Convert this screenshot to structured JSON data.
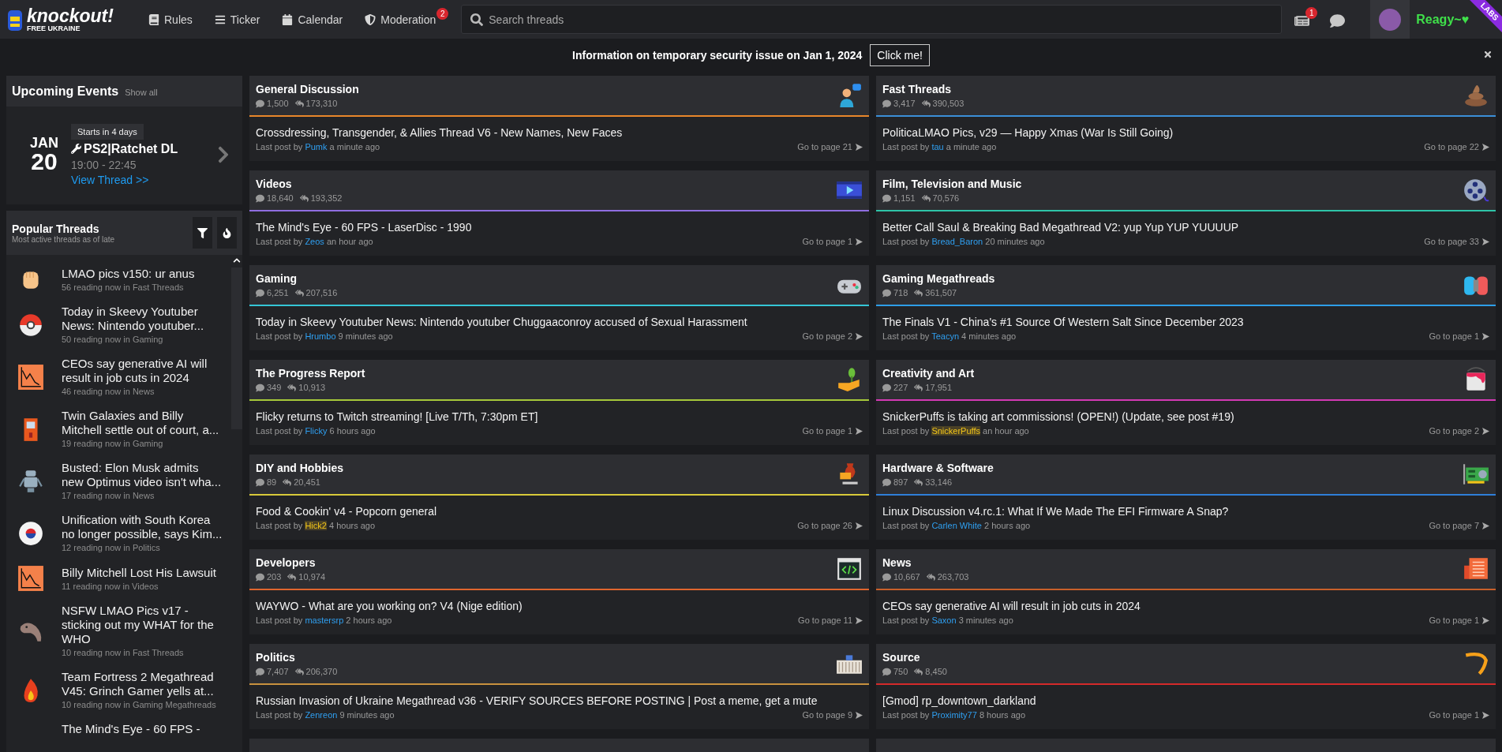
{
  "header": {
    "logo": {
      "name": "knockout!",
      "tagline": "FREE UKRAINE"
    },
    "nav": [
      {
        "kind": "rules",
        "label": "Rules"
      },
      {
        "kind": "ticker",
        "label": "Ticker"
      },
      {
        "kind": "calendar",
        "label": "Calendar"
      },
      {
        "kind": "moderation",
        "label": "Moderation",
        "badge": "2"
      }
    ],
    "search": {
      "placeholder": "Search threads"
    },
    "inbox_badge": "1",
    "username": "Reagy~♥",
    "ribbon": "LABS"
  },
  "banner": {
    "text": "Information on temporary security issue on Jan 1, 2024",
    "button": "Click me!"
  },
  "upcoming_events": {
    "title": "Upcoming Events",
    "show_all": "Show all",
    "event": {
      "month": "JAN",
      "day": "20",
      "starts": "Starts in 4 days",
      "title": "PS2|Ratchet DL",
      "time": "19:00 - 22:45",
      "link": "View Thread >>"
    }
  },
  "popular_threads": {
    "title": "Popular Threads",
    "subtitle": "Most active threads as of late",
    "items": [
      {
        "title": "LMAO pics v150: ur anus",
        "meta": "56 reading now in Fast Threads"
      },
      {
        "title": "Today in Skeevy Youtuber News: Nintendo youtuber...",
        "meta": "50 reading now in Gaming"
      },
      {
        "title": "CEOs say generative AI will result in job cuts in 2024",
        "meta": "46 reading now in News"
      },
      {
        "title": "Twin Galaxies and Billy Mitchell settle out of court, a...",
        "meta": "19 reading now in Gaming"
      },
      {
        "title": "Busted: Elon Musk admits new Optimus video isn't wha...",
        "meta": "17 reading now in News"
      },
      {
        "title": "Unification with South Korea no longer possible, says Kim...",
        "meta": "12 reading now in Politics"
      },
      {
        "title": "Billy Mitchell Lost His Lawsuit",
        "meta": "11 reading now in Videos"
      },
      {
        "title": "NSFW LMAO Pics v17 - sticking out my WHAT for the WHO",
        "meta": "10 reading now in Fast Threads"
      },
      {
        "title": "Team Fortress 2 Megathread V45: Grinch Gamer yells at...",
        "meta": "10 reading now in Gaming Megathreads"
      },
      {
        "title": "The Mind's Eye - 60 FPS -"
      }
    ]
  },
  "columns": [
    {
      "categories": [
        {
          "name": "General Discussion",
          "threads": "1,500",
          "posts": "173,310",
          "color": "#e8862a",
          "thread": "Crossdressing, Transgender, & Allies Thread V6 - New Names, New Faces",
          "last_post": {
            "prefix": "Last post by",
            "user": "Pumk",
            "highlighted": false,
            "time": "a minute ago"
          },
          "page": "Go to page 21"
        },
        {
          "name": "Videos",
          "threads": "18,640",
          "posts": "193,352",
          "color": "#8f6ee0",
          "thread": "The Mind's Eye - 60 FPS - LaserDisc - 1990",
          "last_post": {
            "prefix": "Last post by",
            "user": "Zeos",
            "highlighted": false,
            "time": "an hour ago"
          },
          "page": "Go to page 1"
        },
        {
          "name": "Gaming",
          "threads": "6,251",
          "posts": "207,516",
          "color": "#35c6d6",
          "thread": "Today in Skeevy Youtuber News: Nintendo youtuber Chuggaaconroy accused of Sexual Harassment",
          "last_post": {
            "prefix": "Last post by",
            "user": "Hrumbo",
            "highlighted": false,
            "time": "9 minutes ago"
          },
          "page": "Go to page 2"
        },
        {
          "name": "The Progress Report",
          "threads": "349",
          "posts": "10,913",
          "color": "#a6c93a",
          "thread": "Flicky returns to Twitch streaming! [Live T/Th, 7:30pm ET]",
          "last_post": {
            "prefix": "Last post by",
            "user": "Flicky",
            "highlighted": false,
            "time": "6 hours ago"
          },
          "page": "Go to page 1"
        },
        {
          "name": "DIY and Hobbies",
          "threads": "89",
          "posts": "20,451",
          "color": "#d8c93a",
          "thread": "Food & Cookin' v4 - Popcorn general",
          "last_post": {
            "prefix": "Last post by",
            "user": "Hick2",
            "highlighted": true,
            "time": "4 hours ago"
          },
          "page": "Go to page 26"
        },
        {
          "name": "Developers",
          "threads": "203",
          "posts": "10,974",
          "color": "#e0652e",
          "thread": "WAYWO - What are you working on? V4 (Nige edition)",
          "last_post": {
            "prefix": "Last post by",
            "user": "mastersrp",
            "highlighted": false,
            "time": "2 hours ago"
          },
          "page": "Go to page 11"
        },
        {
          "name": "Politics",
          "threads": "7,407",
          "posts": "206,370",
          "color": "#c8913e",
          "thread": "Russian Invasion of Ukraine Megathread v36 - VERIFY SOURCES BEFORE POSTING | Post a meme, get a mute",
          "last_post": {
            "prefix": "Last post by",
            "user": "Zenreon",
            "highlighted": false,
            "time": "9 minutes ago"
          },
          "page": "Go to page 9"
        }
      ]
    },
    {
      "categories": [
        {
          "name": "Fast Threads",
          "threads": "3,417",
          "posts": "390,503",
          "color": "#3b8fd8",
          "thread": "PoliticaLMAO Pics, v29 — Happy Xmas (War Is Still Going)",
          "last_post": {
            "prefix": "Last post by",
            "user": "tau",
            "highlighted": false,
            "time": "a minute ago"
          },
          "page": "Go to page 22"
        },
        {
          "name": "Film, Television and Music",
          "threads": "1,151",
          "posts": "70,576",
          "color": "#2ec4a8",
          "thread": "Better Call Saul & Breaking Bad Megathread V2: yup Yup YUP YUUUUP",
          "last_post": {
            "prefix": "Last post by",
            "user": "Bread_Baron",
            "highlighted": false,
            "time": "20 minutes ago"
          },
          "page": "Go to page 33"
        },
        {
          "name": "Gaming Megathreads",
          "threads": "718",
          "posts": "361,507",
          "color": "#2e9ee8",
          "thread": "The Finals V1 - China's #1 Source Of Western Salt Since December 2023",
          "last_post": {
            "prefix": "Last post by",
            "user": "Teacyn",
            "highlighted": false,
            "time": "4 minutes ago"
          },
          "page": "Go to page 1"
        },
        {
          "name": "Creativity and Art",
          "threads": "227",
          "posts": "17,951",
          "color": "#d43ab4",
          "thread": "SnickerPuffs is taking art commissions! (OPEN!) (Update, see post #19)",
          "last_post": {
            "prefix": "Last post by",
            "user": "SnickerPuffs",
            "highlighted": true,
            "time": "an hour ago"
          },
          "page": "Go to page 2"
        },
        {
          "name": "Hardware & Software",
          "threads": "897",
          "posts": "33,146",
          "color": "#2e7ed8",
          "thread": "Linux Discussion v4.rc.1: What If We Made The EFI Firmware A Snap?",
          "last_post": {
            "prefix": "Last post by",
            "user": "Carlen White",
            "highlighted": false,
            "time": "2 hours ago"
          },
          "page": "Go to page 7"
        },
        {
          "name": "News",
          "threads": "10,667",
          "posts": "263,703",
          "color": "#c8602a",
          "thread": "CEOs say generative AI will result in job cuts in 2024",
          "last_post": {
            "prefix": "Last post by",
            "user": "Saxon",
            "highlighted": false,
            "time": "3 minutes ago"
          },
          "page": "Go to page 1"
        },
        {
          "name": "Source",
          "threads": "750",
          "posts": "8,450",
          "color": "#d42a2a",
          "thread": "[Gmod] rp_downtown_darkland",
          "last_post": {
            "prefix": "Last post by",
            "user": "Proximity77",
            "highlighted": false,
            "time": "8 hours ago"
          },
          "page": "Go to page 1"
        }
      ]
    }
  ]
}
